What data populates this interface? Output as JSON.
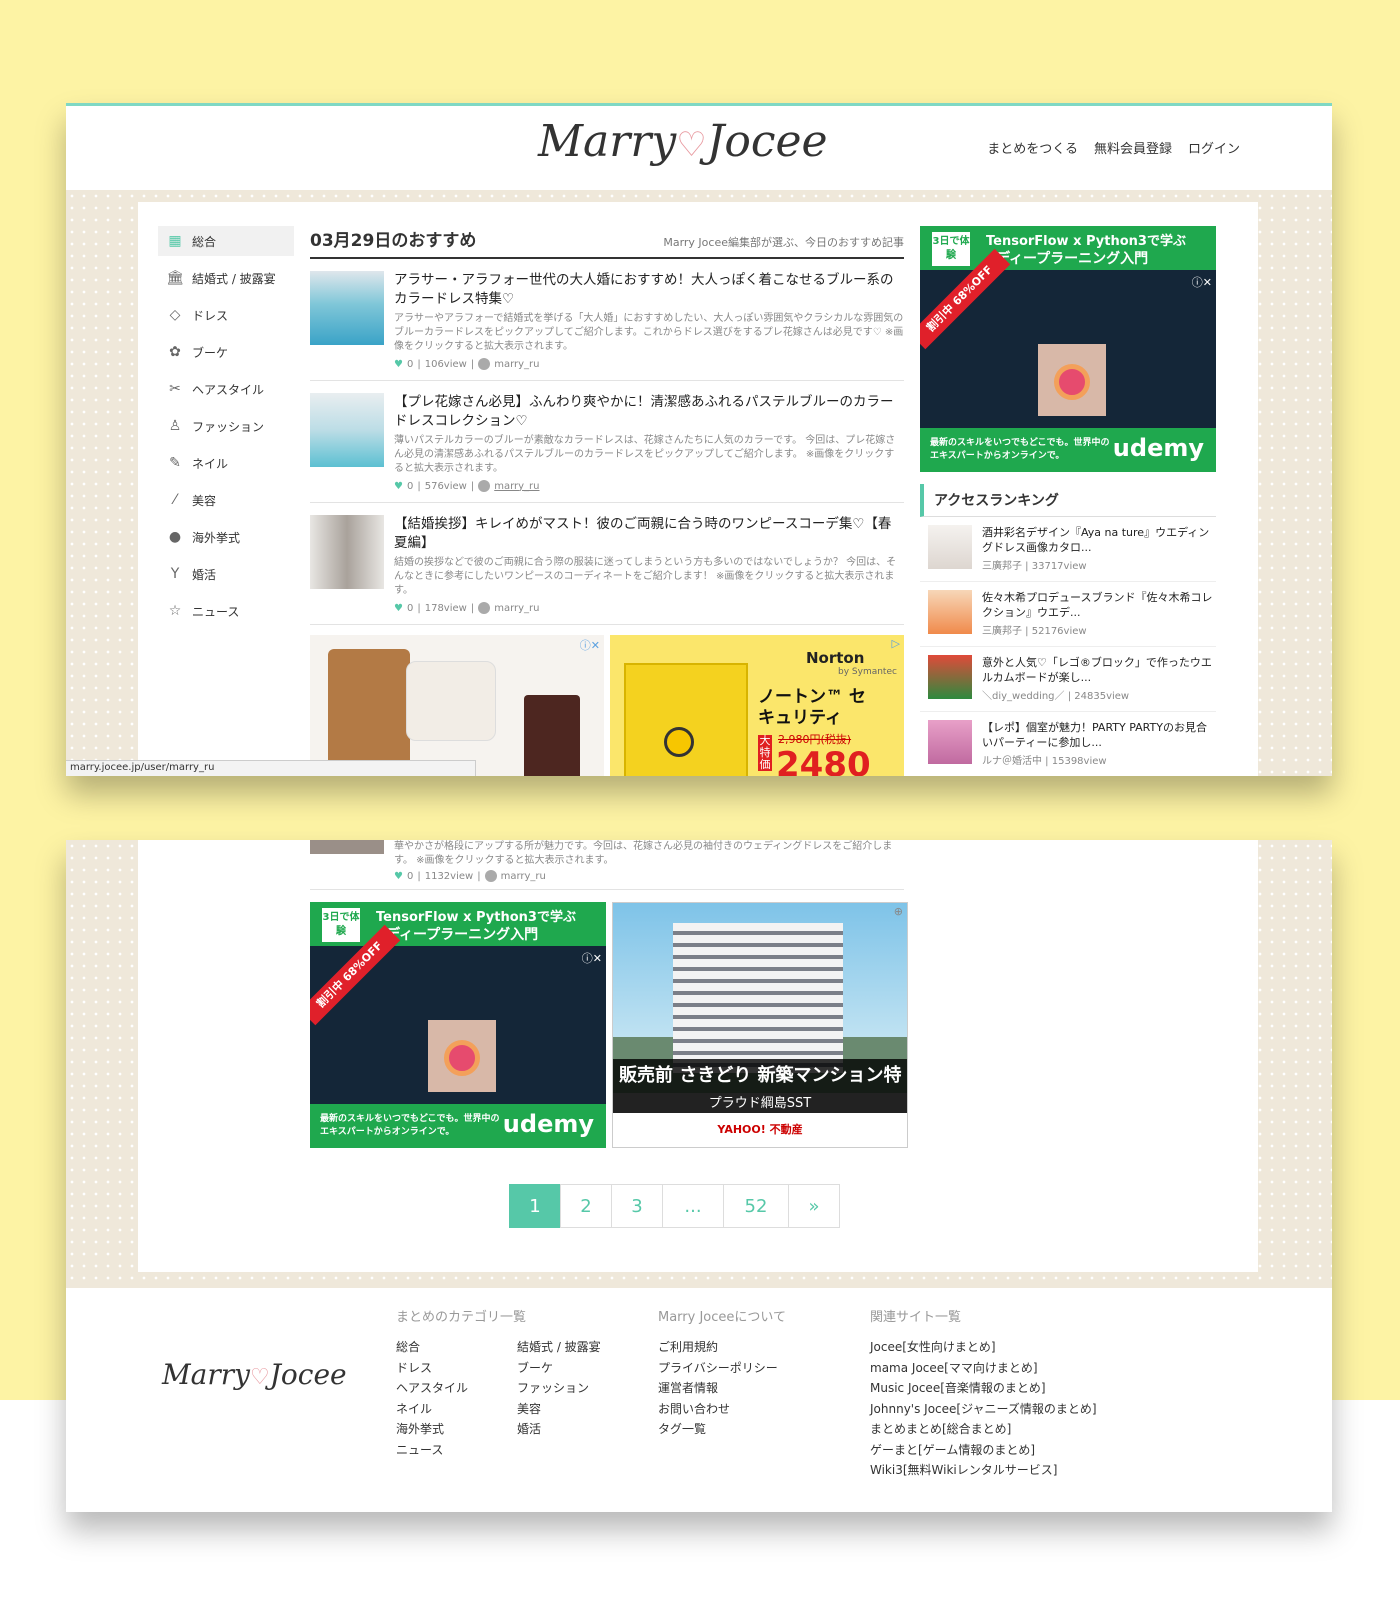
{
  "header": {
    "logo_left": "Marry",
    "logo_right": "Jocee",
    "nav": [
      "まとめをつくる",
      "無料会員登録",
      "ログイン"
    ]
  },
  "sidebar": {
    "categories": [
      {
        "label": "総合",
        "icon": "grid-icon"
      },
      {
        "label": "結婚式 / 披露宴",
        "icon": "building-icon"
      },
      {
        "label": "ドレス",
        "icon": "diamond-icon"
      },
      {
        "label": "ブーケ",
        "icon": "bouquet-icon"
      },
      {
        "label": "ヘアスタイル",
        "icon": "scissors-icon"
      },
      {
        "label": "ファッション",
        "icon": "person-icon"
      },
      {
        "label": "ネイル",
        "icon": "nail-brush-icon"
      },
      {
        "label": "美容",
        "icon": "wand-icon"
      },
      {
        "label": "海外挙式",
        "icon": "globe-icon"
      },
      {
        "label": "婚活",
        "icon": "glass-icon"
      },
      {
        "label": "ニュース",
        "icon": "star-icon"
      }
    ]
  },
  "main": {
    "title": "03月29日のおすすめ",
    "subtitle": "Marry Jocee編集部が選ぶ、今日のおすすめ記事",
    "articles": [
      {
        "title": "アラサー・アラフォー世代の大人婚におすすめ！大人っぽく着こなせるブルー系のカラードレス特集♡",
        "desc": "アラサーやアラフォーで結婚式を挙げる「大人婚」におすすめしたい、大人っぽい雰囲気やクラシカルな雰囲気のブルーカラードレスをピックアップしてご紹介します。これからドレス選びをするプレ花嫁さんは必見です♡ ※画像をクリックすると拡大表示されます。",
        "likes": "0",
        "views": "106view",
        "user": "marry_ru"
      },
      {
        "title": "【プレ花嫁さん必見】ふんわり爽やかに！清潔感あふれるパステルブルーのカラードレスコレクション♡",
        "desc": "薄いパステルカラーのブルーが素敵なカラードレスは、花嫁さんたちに人気のカラーです。 今回は、プレ花嫁さん必見の清潔感あふれるパステルブルーのカラードレスをピックアップしてご紹介します。 ※画像をクリックすると拡大表示されます。",
        "likes": "0",
        "views": "576view",
        "user": "marry_ru"
      },
      {
        "title": "【結婚挨拶】キレイめがマスト！彼のご両親に合う時のワンピースコーデ集♡【春夏編】",
        "desc": "結婚の挨拶などで彼のご両親に合う際の服装に迷ってしまうという方も多いのではないでしょうか？ 今回は、そんなときに参考にしたいワンピースのコーディネートをご紹介します！ ※画像をクリックすると拡大表示されます。",
        "likes": "0",
        "views": "178view",
        "user": "marry_ru"
      }
    ],
    "ad_norton": {
      "brand": "Norton",
      "brand_sub": "by Symantec",
      "product": "ノートン™ セキュリティ",
      "old_price": "2,980円(税抜)",
      "price": "2480",
      "tag": "大特価"
    }
  },
  "right": {
    "udemy_ad": {
      "badge": "3日で体験",
      "line1": "TensorFlow x Python3で学ぶ",
      "line2": "ディープラーニング入門",
      "ribbon": "割引中 68%OFF",
      "foot": "最新のスキルをいつでもどこでも。世界中のエキスパートからオンラインで。",
      "brand": "udemy"
    },
    "ranking_title": "アクセスランキング",
    "ranking": [
      {
        "title": "酒井彩名デザイン『Aya na ture』ウエディングドレス画像カタロ...",
        "meta": "三廣邦子 | 33717view"
      },
      {
        "title": "佐々木希プロデュースブランド『佐々木希コレクション』ウエデ...",
        "meta": "三廣邦子 | 52176view"
      },
      {
        "title": "意外と人気♡「レゴ®ブロック」で作ったウエルカムボードが楽し...",
        "meta": "＼diy_wedding／ | 24835view"
      },
      {
        "title": "【レポ】個室が魅力！PARTY PARTYのお見合いパーティーに参加し...",
        "meta": "ルナ＠婚活中 | 15398view"
      }
    ]
  },
  "status_url": "marry.jocee.jp/user/marry_ru",
  "bottom": {
    "partial_desc": "華やかさが格段にアップする所が魅力です。今回は、花嫁さん必見の袖付きのウェディングドレスをご紹介します。 ※画像をクリックすると拡大表示されます。",
    "partial_meta": {
      "likes": "0",
      "views": "1132view",
      "user": "marry_ru"
    },
    "bldg_ad": {
      "band": "販売前 さきどり 新築マンション特集",
      "name": "プラウド綱島SST",
      "foot": "YAHOO! 不動産"
    },
    "pager": [
      "1",
      "2",
      "3",
      "...",
      "52",
      "»"
    ]
  },
  "footer": {
    "logo_left": "Marry",
    "logo_right": "Jocee",
    "categories_title": "まとめのカテゴリ一覧",
    "categories": [
      "総合",
      "結婚式 / 披露宴",
      "ドレス",
      "ブーケ",
      "ヘアスタイル",
      "ファッション",
      "ネイル",
      "美容",
      "海外挙式",
      "婚活",
      "ニュース"
    ],
    "about_title": "Marry Joceeについて",
    "about": [
      "ご利用規約",
      "プライバシーポリシー",
      "運営者情報",
      "お問い合わせ",
      "タグ一覧"
    ],
    "related_title": "関連サイト一覧",
    "related": [
      "Jocee[女性向けまとめ]",
      "mama Jocee[ママ向けまとめ]",
      "Music Jocee[音楽情報のまとめ]",
      "Johnny's Jocee[ジャニーズ情報のまとめ]",
      "まとめまとめ[総合まとめ]",
      "ゲーまと[ゲーム情報のまとめ]",
      "Wiki3[無料Wikiレンタルサービス]"
    ]
  },
  "colors": {
    "accent": "#56c8a8",
    "page_bg": "#fdf3a4",
    "pattern_bg": "#efe8da",
    "udemy_green": "#1fa84e"
  }
}
